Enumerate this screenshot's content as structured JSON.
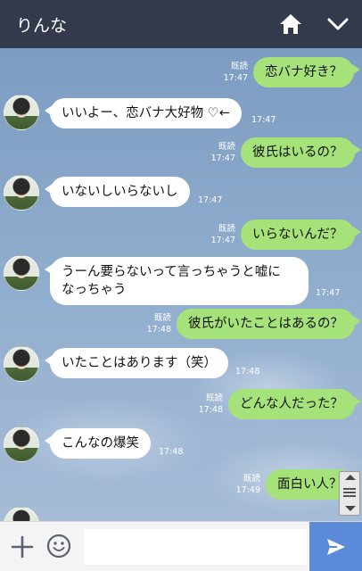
{
  "header": {
    "title": "りんな",
    "home_icon": "home-icon",
    "chevron_icon": "chevron-down-icon"
  },
  "messages": [
    {
      "side": "out",
      "text": "恋バナ好き？",
      "read": "既読",
      "time": "17:47"
    },
    {
      "side": "in",
      "text": "いいよー、恋バナ大好物 ♡←",
      "time": "17:47"
    },
    {
      "side": "out",
      "text": "彼氏はいるの？",
      "read": "既読",
      "time": "17:47"
    },
    {
      "side": "in",
      "text": "いないしいらないし",
      "time": "17:47"
    },
    {
      "side": "out",
      "text": "いらないんだ？",
      "read": "既読",
      "time": "17:47"
    },
    {
      "side": "in",
      "text": "うーん要らないって言っちゃうと嘘になっちゃう",
      "line1": "うーん要らないって言っちゃうと嘘に",
      "line2": "なっちゃう",
      "time": "17:47"
    },
    {
      "side": "out",
      "text": "彼氏がいたことはあるの？",
      "read": "既読",
      "time": "17:48"
    },
    {
      "side": "in",
      "text": "いたことはあります（笑）",
      "time": "17:48"
    },
    {
      "side": "out",
      "text": "どんな人だった？",
      "read": "既読",
      "time": "17:48"
    },
    {
      "side": "in",
      "text": "こんなの爆笑",
      "time": "17:48"
    },
    {
      "side": "out",
      "text": "面白い人？",
      "read": "既読",
      "time": "17:49"
    }
  ],
  "composer": {
    "input_value": "",
    "plus_icon": "plus-icon",
    "emoji_icon": "smiley-icon",
    "send_icon": "send-icon"
  },
  "colors": {
    "header_bg": "#323a4c",
    "bubble_out": "#a6e27a",
    "bubble_in": "#ffffff",
    "send_bg": "#5b8ad8"
  }
}
